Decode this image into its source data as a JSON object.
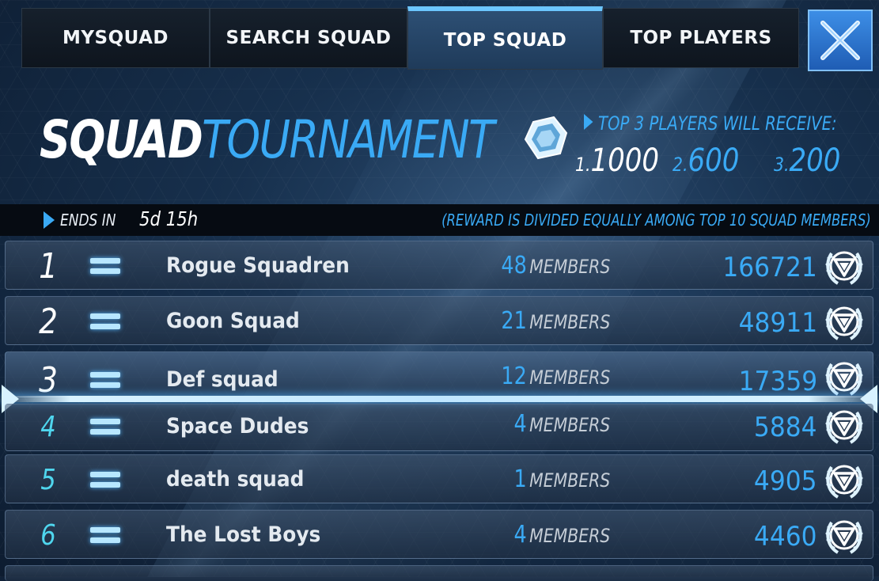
{
  "tabs": [
    {
      "label": "MYSQUAD",
      "active": false
    },
    {
      "label": "SEARCH SQUAD",
      "active": false
    },
    {
      "label": "TOP SQUAD",
      "active": true
    },
    {
      "label": "TOP PLAYERS",
      "active": false
    }
  ],
  "header": {
    "title_part1": "SQUAD",
    "title_part2": "TOURNAMENT",
    "rewards_heading": "TOP 3 PLAYERS WILL RECEIVE:",
    "rewards": [
      {
        "rank": "1.",
        "amount": "1000"
      },
      {
        "rank": "2.",
        "amount": "600"
      },
      {
        "rank": "3.",
        "amount": "200"
      }
    ]
  },
  "ends": {
    "label": "ENDS IN",
    "value": "5d 15h",
    "note": "(REWARD IS DIVIDED EQUALLY AMONG TOP 10 SQUAD MEMBERS)"
  },
  "members_label": "MEMBERS",
  "rows": [
    {
      "rank": "1",
      "name": "Rogue Squadren",
      "members": "48",
      "score": "166721"
    },
    {
      "rank": "2",
      "name": "Goon Squad",
      "members": "21",
      "score": "48911"
    },
    {
      "rank": "3",
      "name": "Def squad",
      "members": "12",
      "score": "17359"
    },
    {
      "rank": "4",
      "name": "Space Dudes",
      "members": "4",
      "score": "5884"
    },
    {
      "rank": "5",
      "name": "death squad",
      "members": "1",
      "score": "4905"
    },
    {
      "rank": "6",
      "name": "The Lost Boys",
      "members": "4",
      "score": "4460"
    }
  ],
  "colors": {
    "accent": "#3aaaf5",
    "rank_cyan": "#4fd6ee",
    "close_bg": "#2f78d6"
  }
}
